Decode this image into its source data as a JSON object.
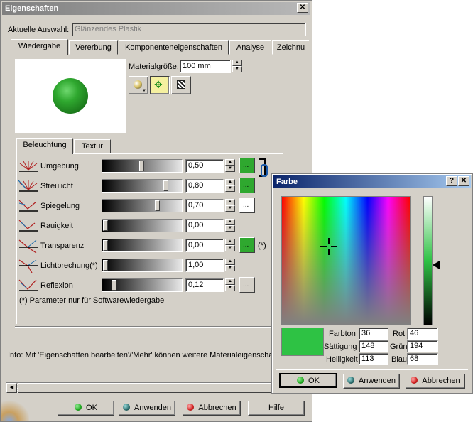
{
  "main_window": {
    "title": "Eigenschaften",
    "close_glyph": "✕",
    "current_selection_label": "Aktuelle Auswahl:",
    "current_selection_value": "Glänzendes Plastik",
    "tabs": [
      {
        "label": "Wiedergabe"
      },
      {
        "label": "Vererbung"
      },
      {
        "label": "Komponenteneigenschaften"
      },
      {
        "label": "Analyse"
      },
      {
        "label": "Zeichnu"
      }
    ],
    "material_size_label": "Materialgröße:",
    "material_size_value": "100 mm",
    "sub_tabs": [
      {
        "label": "Beleuchtung"
      },
      {
        "label": "Textur"
      }
    ],
    "properties": [
      {
        "label": "Umgebung",
        "value": "0,50",
        "level": 0.5,
        "swatch": "#2fa82f",
        "swatch_text": "..."
      },
      {
        "label": "Streulicht",
        "value": "0,80",
        "level": 0.8,
        "swatch": "#2fa82f",
        "swatch_text": "..."
      },
      {
        "label": "Spiegelung",
        "value": "0,70",
        "level": 0.7,
        "swatch": "#ffffff",
        "swatch_text": "..."
      },
      {
        "label": "Rauigkeit",
        "value": "0,00",
        "level": 0.0
      },
      {
        "label": "Transparenz",
        "value": "0,00",
        "level": 0.0,
        "swatch": "#2fa82f",
        "swatch_text": "...",
        "note": "(*)"
      },
      {
        "label": "Lichtbrechung(*)",
        "value": "1,00",
        "level": 0.0
      },
      {
        "label": "Reflexion",
        "value": "0,12",
        "level": 0.12,
        "swatch": "#d4d0c8",
        "swatch_text": "..."
      }
    ],
    "footnote": "(*) Parameter nur für Softwarewiedergabe",
    "info_text": "Info: Mit 'Eigenschaften bearbeiten'/'Mehr' können weitere Materialeigenschaf",
    "buttons": {
      "ok": "OK",
      "apply": "Anwenden",
      "cancel": "Abbrechen",
      "help": "Hilfe"
    }
  },
  "color_dialog": {
    "title": "Farbe",
    "help_glyph": "?",
    "close_glyph": "✕",
    "fields": {
      "hue_label": "Farbton",
      "hue_value": "36",
      "saturation_label": "Sättigung",
      "saturation_value": "148",
      "lightness_label": "Helligkeit",
      "lightness_value": "113",
      "red_label": "Rot",
      "red_value": "46",
      "green_label": "Grün",
      "green_value": "194",
      "blue_label": "Blau",
      "blue_value": "68"
    },
    "selected_color": "#2ec244",
    "buttons": {
      "ok": "OK",
      "apply": "Anwenden",
      "cancel": "Abbrechen"
    }
  },
  "colors": {
    "ok_dot": "#1ea81e",
    "apply_dot": "#2a6a6a",
    "cancel_dot": "#d02020",
    "material_green": "#2fa82f"
  }
}
